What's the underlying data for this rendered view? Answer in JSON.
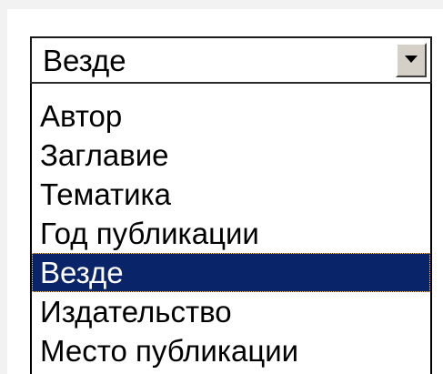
{
  "search_field": {
    "selected_value": "Везде",
    "arrow_icon": "triangle-down-icon",
    "options": [
      "Автор",
      "Заглавие",
      "Тематика",
      "Год публикации",
      "Везде",
      "Издательство",
      "Место публикации"
    ],
    "highlighted_option": "Везде"
  },
  "colors": {
    "highlight_background": "#0a246a",
    "highlight_text": "#ffffff",
    "button_face": "#d4d0c8"
  }
}
